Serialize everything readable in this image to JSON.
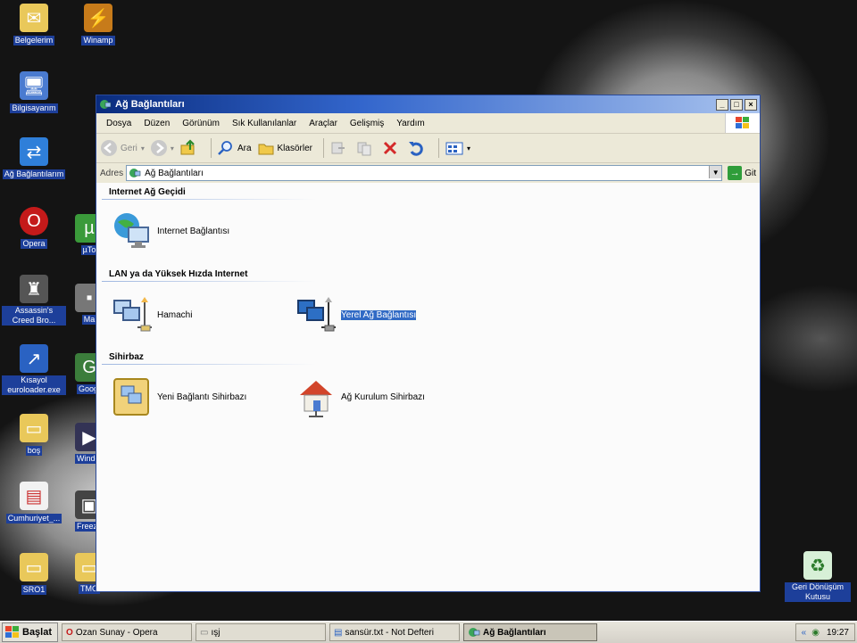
{
  "desktop": {
    "icons": [
      {
        "label": "Belgelerim",
        "icon": "folder-icon"
      },
      {
        "label": "Winamp",
        "icon": "winamp-icon"
      },
      {
        "label": "Bilgisayarım",
        "icon": "computer-icon"
      },
      {
        "label": "Ağ Bağlantılarım",
        "icon": "network-icon"
      },
      {
        "label": "Opera",
        "icon": "opera-icon"
      },
      {
        "label": "Assassin's Creed Bro...",
        "icon": "game-icon"
      },
      {
        "label": "Kısayol euroloader.exe",
        "icon": "shortcut-icon"
      },
      {
        "label": "boş",
        "icon": "folder-icon"
      },
      {
        "label": "Cumhuriyet_...",
        "icon": "document-icon"
      },
      {
        "label": "SRO1",
        "icon": "folder-icon"
      },
      {
        "label": "Geri Dönüşüm Kutusu",
        "icon": "recycle-bin-icon"
      },
      {
        "label": "µTo",
        "icon": "torrent-icon"
      },
      {
        "label": "Ma",
        "icon": "app-icon"
      },
      {
        "label": "Googl",
        "icon": "app-icon"
      },
      {
        "label": "Windo Medi",
        "icon": "app-icon"
      },
      {
        "label": "Freez Video",
        "icon": "app-icon"
      },
      {
        "label": "TMO",
        "icon": "folder-icon"
      }
    ]
  },
  "window": {
    "title": "Ağ Bağlantıları",
    "menu": [
      "Dosya",
      "Düzen",
      "Görünüm",
      "Sık Kullanılanlar",
      "Araçlar",
      "Gelişmiş",
      "Yardım"
    ],
    "toolbar": {
      "back": "Geri",
      "search": "Ara",
      "folders": "Klasörler"
    },
    "address": {
      "label": "Adres",
      "value": "Ağ Bağlantıları",
      "go": "Git"
    },
    "groups": [
      {
        "title": "Internet Ağ Geçidi",
        "items": [
          {
            "label": "Internet Bağlantısı"
          }
        ]
      },
      {
        "title": "LAN ya da Yüksek Hızda Internet",
        "items": [
          {
            "label": "Hamachi"
          },
          {
            "label": "Yerel Ağ Bağlantısı"
          }
        ]
      },
      {
        "title": "Sihirbaz",
        "items": [
          {
            "label": "Yeni Bağlantı Sihirbazı"
          },
          {
            "label": "Ağ Kurulum Sihirbazı"
          }
        ]
      }
    ]
  },
  "taskbar": {
    "start": "Başlat",
    "buttons": [
      {
        "label": "Ozan Sunay - Opera"
      },
      {
        "label": "ışj"
      },
      {
        "label": "sansür.txt - Not Defteri"
      },
      {
        "label": "Ağ Bağlantıları"
      }
    ],
    "clock": "19:27"
  },
  "colors": {
    "titlebar": "#0a2c7e",
    "selection": "#316ac5",
    "icon_label_bg": "#1d3f9a"
  }
}
